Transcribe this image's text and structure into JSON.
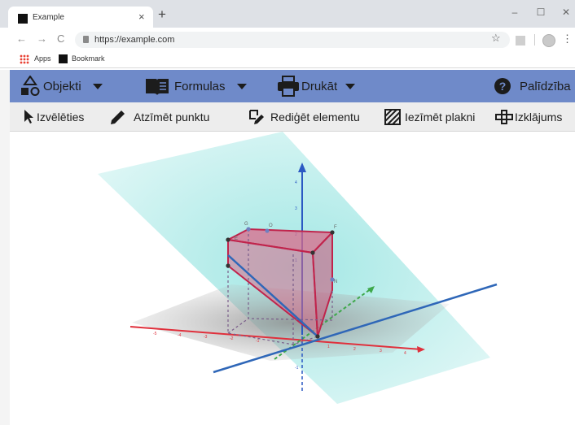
{
  "browser": {
    "tab_title": "Example",
    "tab_close": "×",
    "new_tab": "+",
    "url": "https://example.com",
    "window_controls": [
      "–",
      "☐",
      "✕"
    ],
    "nav": {
      "back": "←",
      "forward": "→",
      "reload": "C"
    },
    "star": "☆",
    "kebab": "⋮",
    "bookmarks": {
      "apps": "Apps",
      "bookmark": "Bookmark"
    }
  },
  "menu": {
    "objects": "Objekti",
    "formulas": "Formulas",
    "print": "Drukāt",
    "help": "Palīdzība"
  },
  "tools": {
    "select": "Izvēlēties",
    "mark_point": "Atzīmēt punktu",
    "edit_element": "Rediģēt elementu",
    "mark_plane": "Iezīmēt plakni",
    "net": "Izklājums"
  },
  "scene": {
    "z_axis_ticks": [
      "4",
      "3",
      "2",
      "1",
      "-1"
    ],
    "x_axis_ticks": [
      "-5",
      "-4",
      "-3",
      "-2",
      "-1",
      "1",
      "2",
      "3",
      "4"
    ],
    "point_labels": [
      "G",
      "O",
      "F",
      "E",
      "N"
    ],
    "colors": {
      "plane": "#9ee6e3",
      "floor_shadow": "#9e9e9e",
      "prism_fill": "#d96a8a",
      "prism_edge": "#c0244c",
      "axis_z": "#2b59c3",
      "axis_x": "#e0303c",
      "axis_y": "#3ea84b",
      "line_blue": "#2f67b8"
    }
  }
}
